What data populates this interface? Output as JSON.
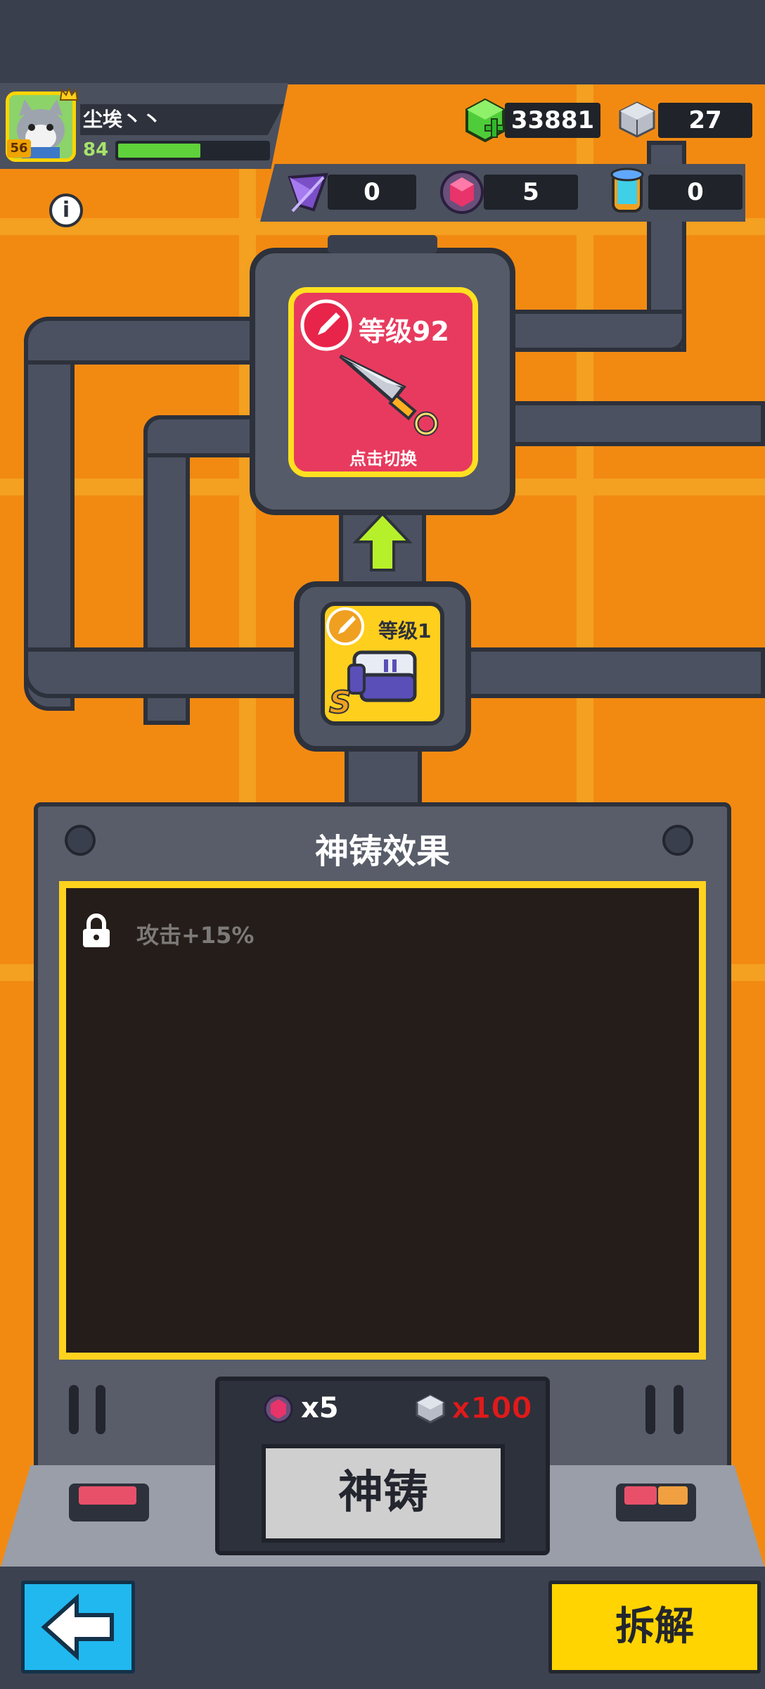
{
  "player": {
    "name": "尘埃丶丶",
    "avatar_level": "56",
    "level": "84",
    "xp_fraction": 0.55
  },
  "currencies": {
    "gems": "33881",
    "cubes": "27",
    "crystal": "0",
    "orb": "5",
    "scroll": "0"
  },
  "weapon_main": {
    "level_label": "等级92",
    "switch_label": "点击切换"
  },
  "weapon_material": {
    "level_label": "等级1",
    "rank": "S"
  },
  "forge_panel": {
    "title": "神铸效果",
    "effects": [
      {
        "text": "攻击+15%",
        "locked": true
      }
    ]
  },
  "cost": {
    "orb_cost": "x5",
    "cube_cost": "x100"
  },
  "buttons": {
    "forge": "神铸",
    "dismantle": "拆解"
  },
  "colors": {
    "accent_yellow": "#ffd400",
    "background_orange": "#f28a12",
    "back_button": "#21b8f0",
    "cost_red": "#e01a1a"
  }
}
